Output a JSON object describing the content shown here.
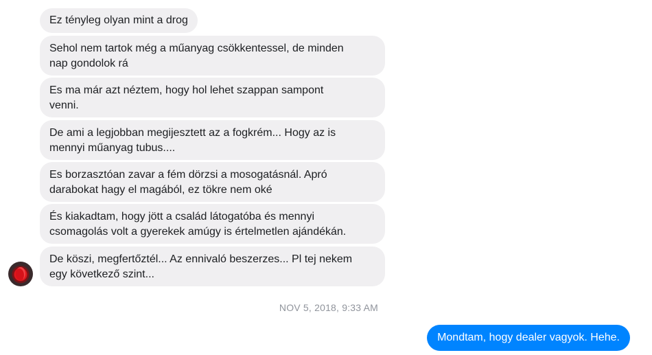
{
  "conversation": {
    "received_messages": [
      {
        "lines": [
          "Ez tényleg olyan mint a drog"
        ]
      },
      {
        "lines": [
          "Sehol nem tartok még a műanyag csökkentessel, de minden",
          "nap gondolok rá"
        ]
      },
      {
        "lines": [
          "Es ma már azt néztem, hogy hol lehet szappan sampont",
          "venni."
        ]
      },
      {
        "lines": [
          "De ami a legjobban megijesztett az a fogkrém... Hogy az is",
          "mennyi műanyag tubus...."
        ]
      },
      {
        "lines": [
          "Es borzasztóan zavar a fém dörzsi a mosogatásnál. Apró",
          "darabokat hagy el magából, ez tökre nem oké"
        ]
      },
      {
        "lines": [
          "És kiakadtam, hogy jött a család látogatóba és mennyi",
          "csomagolás volt a gyerekek amúgy is értelmetlen ajándékán."
        ]
      },
      {
        "lines": [
          "De köszi, megfertőztél... Az ennivaló beszerzes... Pl tej nekem",
          "egy következő szint..."
        ]
      }
    ],
    "timestamp": "NOV 5, 2018, 9:33 AM",
    "sent_message": "Mondtam, hogy dealer vagyok. Hehe.",
    "colors": {
      "received_bubble": "#f0eff1",
      "sent_bubble": "#0084ff",
      "timestamp_text": "#90949c"
    }
  }
}
